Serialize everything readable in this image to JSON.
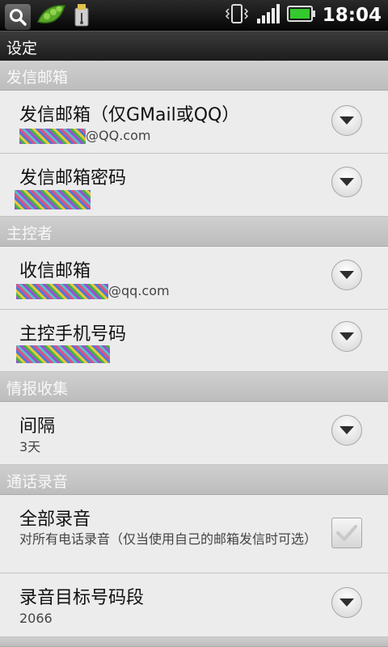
{
  "status_bar": {
    "time": "18:04",
    "icons": [
      "search-icon",
      "peapod-icon",
      "usb-icon",
      "vibrate-icon",
      "signal-icon",
      "battery-icon"
    ]
  },
  "title": "设定",
  "sections": {
    "sender": {
      "header": "发信邮箱",
      "email": {
        "title": "发信邮箱（仅GMail或QQ）",
        "domain": "@QQ.com"
      },
      "password": {
        "title": "发信邮箱密码"
      }
    },
    "controller": {
      "header": "主控者",
      "inbox": {
        "title": "收信邮箱",
        "domain": "@qq.com"
      },
      "phone": {
        "title": "主控手机号码"
      }
    },
    "intel": {
      "header": "情报收集",
      "interval": {
        "title": "间隔",
        "value": "3天"
      }
    },
    "recording": {
      "header": "通话录音",
      "record_all": {
        "title": "全部录音",
        "summary": "对所有电话录音（仅当使用自己的邮箱发信时可选）",
        "checked": true
      },
      "target": {
        "title": "录音目标号码段",
        "value": "2066"
      }
    }
  },
  "colors": {
    "section_header": "#c6c6c6",
    "list_bg": "#ececec",
    "status_bar": "#000000"
  }
}
